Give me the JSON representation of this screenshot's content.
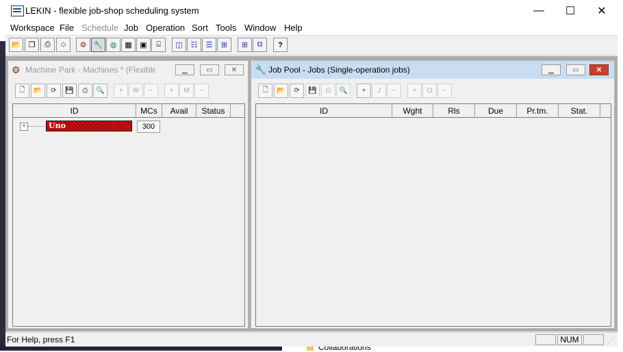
{
  "window": {
    "title": "LEKIN - flexible job-shop scheduling system",
    "minimize": "—",
    "maximize": "☐",
    "close": "✕"
  },
  "menu": [
    {
      "label": "Workspace",
      "enabled": true
    },
    {
      "label": "File",
      "enabled": true
    },
    {
      "label": "Schedule",
      "enabled": false
    },
    {
      "label": "Job",
      "enabled": true
    },
    {
      "label": "Operation",
      "enabled": true
    },
    {
      "label": "Sort",
      "enabled": true
    },
    {
      "label": "Tools",
      "enabled": true
    },
    {
      "label": "Window",
      "enabled": true
    },
    {
      "label": "Help",
      "enabled": true
    }
  ],
  "toolbar_icons": [
    "open-workspace-icon",
    "copy-icon",
    "print-icon",
    "diamond-arrows-icon",
    "machine-icon",
    "wrench-icon",
    "globe-icon",
    "gantt-chart-icon",
    "chart-icon",
    "sequence-icon",
    "gantt-icon",
    "gantt-rows-icon",
    "gantt-multi-icon",
    "gantt-sort-icon",
    "grid-icon",
    "windows-icon",
    "help-icon"
  ],
  "machine_park": {
    "title": "Machine Park - Machines * (Flexible W...",
    "columns": [
      "ID",
      "MCs",
      "Avail",
      "Status"
    ],
    "rows": [
      {
        "id": "Uno",
        "mcs": "300",
        "avail": "",
        "status": ""
      }
    ],
    "expander": "+"
  },
  "job_pool": {
    "title": "Job Pool - Jobs (Single-operation jobs)",
    "columns": [
      "ID",
      "Wght",
      "Rls",
      "Due",
      "Pr.tm.",
      "Stat."
    ],
    "rows": []
  },
  "statusbar": {
    "help": "For Help, press F1",
    "num": "NUM"
  },
  "desktop": {
    "collaborations": "Collaborations"
  },
  "colors": {
    "active_title": "#c9ddf2",
    "mdi_background": "#ababab",
    "machine_hatch": "#cc1111"
  }
}
